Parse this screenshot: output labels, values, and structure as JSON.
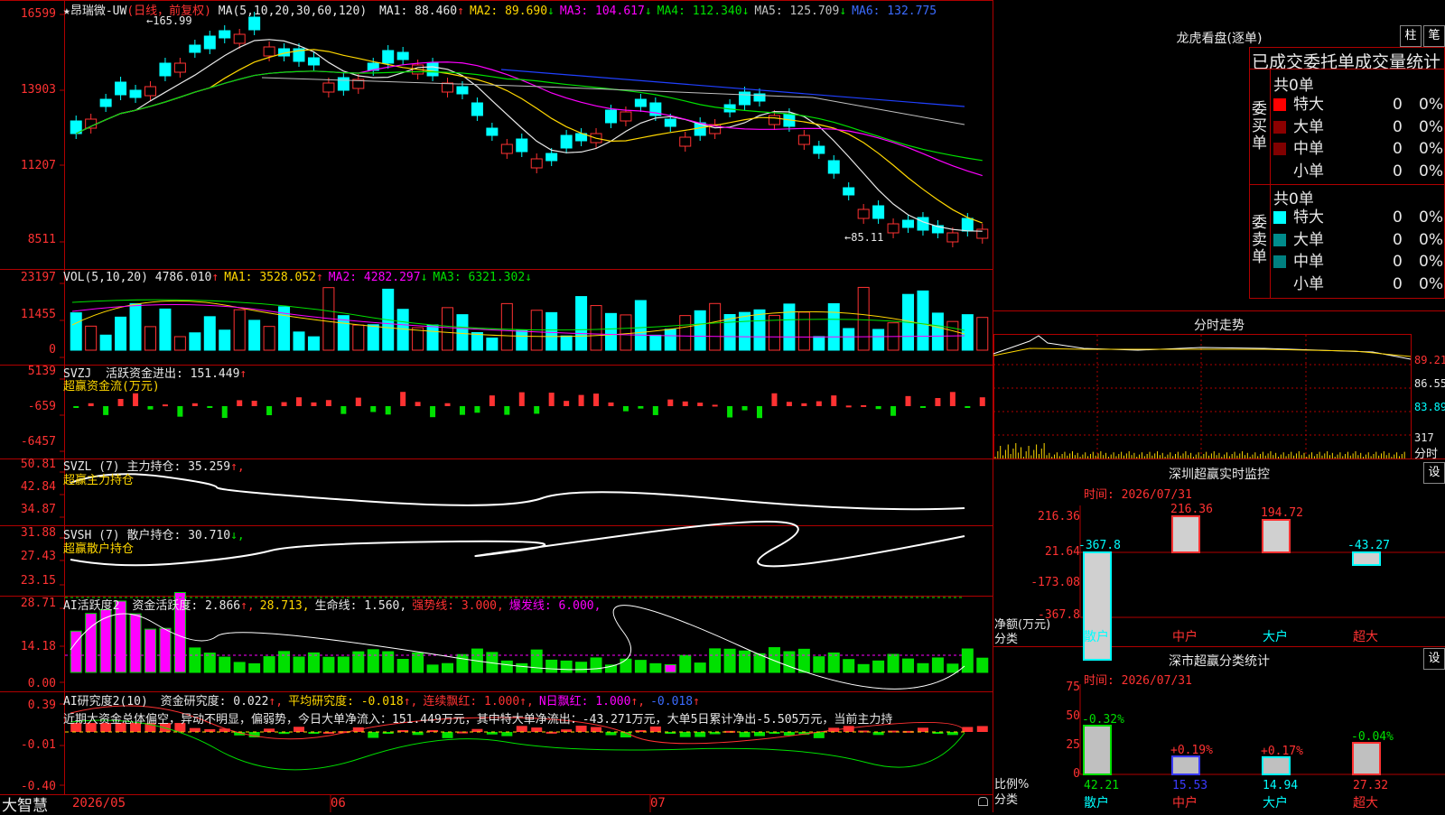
{
  "stock": {
    "star": "★",
    "name": "昂瑞微-UW",
    "period": "(日线，前复权)",
    "ma_label": "MA(5,10,20,30,60,120)",
    "ma": [
      {
        "label": "MA1:",
        "value": "88.460",
        "arrow": "↑",
        "color": "#e8e8e8"
      },
      {
        "label": "MA2:",
        "value": "89.690",
        "arrow": "↓",
        "color": "#ffd700"
      },
      {
        "label": "MA3:",
        "value": "104.617",
        "arrow": "↓",
        "color": "#ff00ff"
      },
      {
        "label": "MA4:",
        "value": "112.340",
        "arrow": "↓",
        "color": "#00e000"
      },
      {
        "label": "MA5:",
        "value": "125.709",
        "arrow": "↓",
        "color": "#c0c0c0"
      },
      {
        "label": "MA6:",
        "value": "132.775",
        "arrow": "",
        "color": "#3b6bff"
      }
    ],
    "high_mark": "165.99",
    "low_mark": "←85.11",
    "y_labels": [
      "16599",
      "13903",
      "11207",
      "8511"
    ]
  },
  "volume": {
    "title": "VOL(5,10,20)",
    "value": "4786.010",
    "value_arrow": "↑",
    "ma": [
      {
        "label": "MA1:",
        "value": "3528.052",
        "arrow": "↑",
        "color": "#ffd700"
      },
      {
        "label": "MA2:",
        "value": "4282.297",
        "arrow": "↓",
        "color": "#ff00ff"
      },
      {
        "label": "MA3:",
        "value": "6321.302",
        "arrow": "↓",
        "color": "#00e000"
      }
    ],
    "y_labels": [
      "23197",
      "11455",
      "0"
    ]
  },
  "svzj": {
    "title": "SVZJ",
    "label": "活跃资金进出:",
    "value": "151.449",
    "arrow": "↑",
    "sub": "超赢资金流(万元)",
    "y_labels": [
      "5139",
      "-659",
      "-6457"
    ]
  },
  "svzl": {
    "title": "SVZL (7)",
    "label": "主力持仓:",
    "value": "35.259",
    "arrow": "↑,",
    "sub": "超赢主力持仓",
    "y_labels": [
      "50.81",
      "42.84",
      "34.87"
    ]
  },
  "svsh": {
    "title": "SVSH (7)",
    "label": "散户持仓:",
    "value": "30.710",
    "arrow": "↓,",
    "sub": "超赢散户持仓",
    "y_labels": [
      "31.88",
      "27.43",
      "23.15"
    ]
  },
  "ai1": {
    "title": "AI活跃度2",
    "items": [
      {
        "text": "资金活跃度: 2.866",
        "arrow": "↑,",
        "color": "#e8e8e8"
      },
      {
        "text": "28.713,",
        "arrow": "",
        "color": "#ffd700"
      },
      {
        "text": "生命线: 1.560,",
        "arrow": "",
        "color": "#e8e8e8"
      },
      {
        "text": "强势线: 3.000,",
        "arrow": "",
        "color": "#ff3232"
      },
      {
        "text": "爆发线: 6.000,",
        "arrow": "",
        "color": "#ff00ff"
      }
    ],
    "y_labels": [
      "28.71",
      "14.18",
      "0.00"
    ]
  },
  "ai2": {
    "title": "AI研究度2(10)",
    "items": [
      {
        "text": "资金研究度: 0.022",
        "arrow": "↑,",
        "color": "#e8e8e8"
      },
      {
        "text": "平均研究度: -0.018",
        "arrow": "↑,",
        "color": "#ffd700"
      },
      {
        "text": "连续飘红: 1.000",
        "arrow": "↑,",
        "color": "#ff3232"
      },
      {
        "text": "N日飘红: 1.000",
        "arrow": "↑,",
        "color": "#ff00ff"
      },
      {
        "text": "-0.018",
        "arrow": "↑",
        "color": "#3b6bff"
      }
    ],
    "commentary": "近期大资金总体偏空，异动不明显，偏弱势，今日大单净流入：151.449万元，其中特大单净流出：-43.271万元，大单5日累计净出-5.505万元，当前主力持",
    "y_labels": [
      "0.39",
      "-0.01",
      "-0.40"
    ]
  },
  "bottom": {
    "logo": "大智慧",
    "dates": [
      "2026/05",
      "06",
      "07"
    ]
  },
  "dragon": {
    "title": "龙虎看盘(逐单)",
    "btn1": "柱",
    "btn2": "笔",
    "header": "已成交委托单成交量统计",
    "buy": {
      "label": "委买单",
      "total": "共0单",
      "rows": [
        {
          "name": "特大",
          "count": "0",
          "pct": "0%",
          "color": "#ff0000"
        },
        {
          "name": "大单",
          "count": "0",
          "pct": "0%",
          "color": "#8b0000"
        },
        {
          "name": "中单",
          "count": "0",
          "pct": "0%",
          "color": "#800000"
        },
        {
          "name": "小单",
          "count": "0",
          "pct": "0%",
          "color": "#000000"
        }
      ]
    },
    "sell": {
      "label": "委卖单",
      "total": "共0单",
      "rows": [
        {
          "name": "特大",
          "count": "0",
          "pct": "0%",
          "color": "#00ffff"
        },
        {
          "name": "大单",
          "count": "0",
          "pct": "0%",
          "color": "#008b8b"
        },
        {
          "name": "中单",
          "count": "0",
          "pct": "0%",
          "color": "#008080"
        },
        {
          "name": "小单",
          "count": "0",
          "pct": "0%",
          "color": "#000000"
        }
      ]
    }
  },
  "intraday": {
    "title": "分时走势",
    "y_labels": [
      "89.21",
      "86.55",
      "83.89",
      "317",
      "分时"
    ]
  },
  "sz_monitor": {
    "title": "深圳超赢实时监控",
    "set": "设",
    "time": "时间: 2026/07/31",
    "y_labels": [
      "216.36",
      "21.64",
      "-173.08",
      "-367.8"
    ],
    "ylabel1": "净额(万元)",
    "ylabel2": "分类",
    "bars": [
      {
        "cat": "散户",
        "value": -367.8,
        "label": "-367.8",
        "color": "#00ffff"
      },
      {
        "cat": "中户",
        "value": 216.36,
        "label": "216.36",
        "color": "#ff3232"
      },
      {
        "cat": "大户",
        "value": 194.72,
        "label": "194.72",
        "color": "#ff3232"
      },
      {
        "cat": "超大",
        "value": -43.27,
        "label": "-43.27",
        "color": "#00ffff"
      }
    ]
  },
  "sz_class": {
    "title": "深市超赢分类统计",
    "set": "设",
    "time": "时间: 2026/07/31",
    "y_labels": [
      "75",
      "50",
      "25",
      "0"
    ],
    "ylabel1": "比例%",
    "ylabel2": "分类",
    "bars": [
      {
        "cat": "散户",
        "value": 42.21,
        "label": "42.21",
        "delta": "-0.32%",
        "color": "#00e000"
      },
      {
        "cat": "中户",
        "value": 15.53,
        "label": "15.53",
        "delta": "+0.19%",
        "color": "#3b3bff"
      },
      {
        "cat": "大户",
        "value": 14.94,
        "label": "14.94",
        "delta": "+0.17%",
        "color": "#00ffff"
      },
      {
        "cat": "超大",
        "value": 27.32,
        "label": "27.32",
        "delta": "-0.04%",
        "color": "#ff3232"
      }
    ]
  }
}
